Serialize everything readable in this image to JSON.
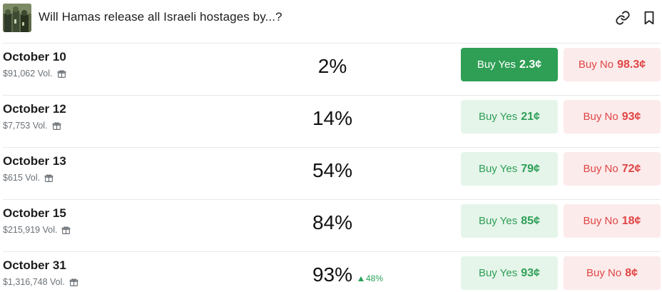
{
  "header": {
    "title": "Will Hamas release all Israeli hostages by...?",
    "thumbnail_icon": "market-image",
    "link_icon": "link-icon",
    "bookmark_icon": "bookmark-icon"
  },
  "colors": {
    "yes_accent": "#2f9f55",
    "yes_bg": "#e5f5ea",
    "no_accent": "#e04545",
    "no_bg": "#fcebeb"
  },
  "outcomes": [
    {
      "date": "October 10",
      "volume": "$91,062 Vol.",
      "percent": "2%",
      "change": "",
      "yes_label": "Buy Yes",
      "yes_price": "2.3¢",
      "no_label": "Buy No",
      "no_price": "98.3¢",
      "yes_active": true
    },
    {
      "date": "October 12",
      "volume": "$7,753 Vol.",
      "percent": "14%",
      "change": "",
      "yes_label": "Buy Yes",
      "yes_price": "21¢",
      "no_label": "Buy No",
      "no_price": "93¢",
      "yes_active": false
    },
    {
      "date": "October 13",
      "volume": "$615 Vol.",
      "percent": "54%",
      "change": "",
      "yes_label": "Buy Yes",
      "yes_price": "79¢",
      "no_label": "Buy No",
      "no_price": "72¢",
      "yes_active": false
    },
    {
      "date": "October 15",
      "volume": "$215,919 Vol.",
      "percent": "84%",
      "change": "",
      "yes_label": "Buy Yes",
      "yes_price": "85¢",
      "no_label": "Buy No",
      "no_price": "18¢",
      "yes_active": false
    },
    {
      "date": "October 31",
      "volume": "$1,316,748 Vol.",
      "percent": "93%",
      "change": "48%",
      "yes_label": "Buy Yes",
      "yes_price": "93¢",
      "no_label": "Buy No",
      "no_price": "8¢",
      "yes_active": false
    }
  ]
}
